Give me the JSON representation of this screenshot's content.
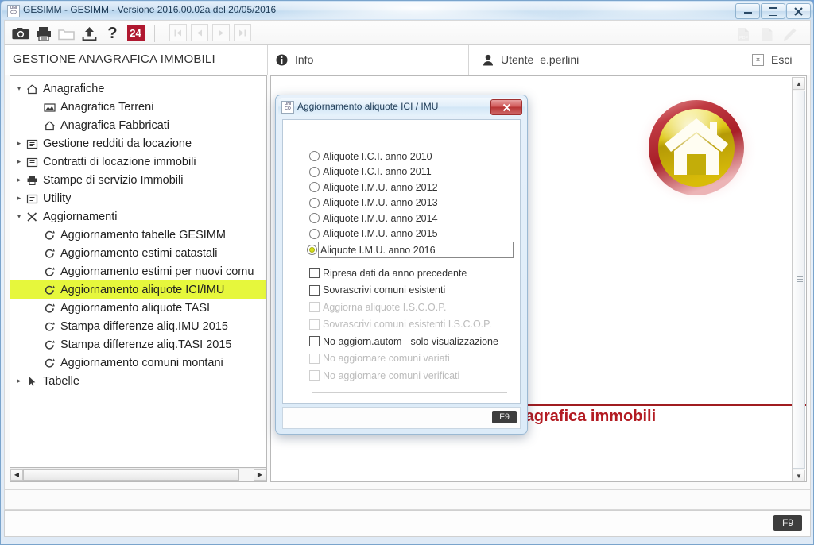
{
  "window": {
    "title": "GESIMM  - GESIMM -  Versione 2016.00.02a  del 20/05/2016",
    "minimize_label": "Minimizza",
    "maximize_label": "Ingrandisci",
    "close_label": "Chiudi"
  },
  "toolbar": {
    "items": [
      {
        "name": "camera-icon",
        "label": "Cattura schermata"
      },
      {
        "name": "print-icon",
        "label": "Stampa"
      },
      {
        "name": "folder-icon",
        "label": "Apri cartella"
      },
      {
        "name": "upload-icon",
        "label": "Esporta"
      },
      {
        "name": "help-icon",
        "label": "?"
      },
      {
        "name": "badge-24",
        "label": "24"
      }
    ],
    "badge_text": "24",
    "help_text": "?",
    "nav": [
      {
        "name": "first-record-button",
        "glyph": "|◀"
      },
      {
        "name": "previous-record-button",
        "glyph": "◀"
      },
      {
        "name": "next-record-button",
        "glyph": "▶"
      },
      {
        "name": "last-record-button",
        "glyph": "▶|"
      }
    ],
    "right_items": [
      {
        "name": "pdf-export-icon",
        "label": "PDF"
      },
      {
        "name": "document-icon",
        "label": "Documento"
      },
      {
        "name": "edit-pencil-icon",
        "label": "Modifica"
      }
    ]
  },
  "header": {
    "title": "GESTIONE ANAGRAFICA IMMOBILI",
    "info_label": "Info",
    "user_caption": "Utente",
    "user_name": "e.perlini",
    "exit_label": "Esci",
    "exit_box_glyph": "×"
  },
  "tree": {
    "items": [
      {
        "label": "Anagrafiche",
        "level": 0,
        "twisty": "▾",
        "icon": "house-icon",
        "selected": false
      },
      {
        "label": "Anagrafica Terreni",
        "level": 1,
        "twisty": "",
        "icon": "land-icon",
        "selected": false
      },
      {
        "label": "Anagrafica Fabbricati",
        "level": 1,
        "twisty": "",
        "icon": "house-icon",
        "selected": false
      },
      {
        "label": "Gestione redditi da locazione",
        "level": 0,
        "twisty": "▸",
        "icon": "form-icon",
        "selected": false
      },
      {
        "label": "Contratti di locazione immobili",
        "level": 0,
        "twisty": "▸",
        "icon": "form-icon",
        "selected": false
      },
      {
        "label": "Stampe di servizio Immobili",
        "level": 0,
        "twisty": "▸",
        "icon": "printer-icon",
        "selected": false
      },
      {
        "label": "Utility",
        "level": 0,
        "twisty": "▸",
        "icon": "form-icon",
        "selected": false
      },
      {
        "label": "Aggiornamenti",
        "level": 0,
        "twisty": "▾",
        "icon": "tools-icon",
        "selected": false
      },
      {
        "label": "Aggiornamento tabelle GESIMM",
        "level": 1,
        "twisty": "",
        "icon": "refresh-icon",
        "selected": false
      },
      {
        "label": "Aggiornamento estimi catastali",
        "level": 1,
        "twisty": "",
        "icon": "refresh-icon",
        "selected": false
      },
      {
        "label": "Aggiornamento estimi per nuovi comu",
        "level": 1,
        "twisty": "",
        "icon": "refresh-icon",
        "selected": false
      },
      {
        "label": "Aggiornamento aliquote ICI/IMU",
        "level": 1,
        "twisty": "",
        "icon": "refresh-icon",
        "selected": true
      },
      {
        "label": "Aggiornamento aliquote TASI",
        "level": 1,
        "twisty": "",
        "icon": "refresh-icon",
        "selected": false
      },
      {
        "label": "Stampa differenze aliq.IMU 2015",
        "level": 1,
        "twisty": "",
        "icon": "refresh-icon",
        "selected": false
      },
      {
        "label": "Stampa differenze aliq.TASI 2015",
        "level": 1,
        "twisty": "",
        "icon": "refresh-icon",
        "selected": false
      },
      {
        "label": "Aggiornamento comuni montani",
        "level": 1,
        "twisty": "",
        "icon": "refresh-icon",
        "selected": false
      },
      {
        "label": "Tabelle",
        "level": 0,
        "twisty": "▸",
        "icon": "pointer-icon",
        "selected": false
      }
    ],
    "hscroll_left_glyph": "◀",
    "hscroll_right_glyph": "▶"
  },
  "content": {
    "logo_name": "home-logo",
    "banner_text": "tione anagrafica immobili",
    "scroll_up_glyph": "▲",
    "scroll_down_glyph": "▼"
  },
  "dialog": {
    "title": "Aggiornamento aliquote ICI / IMU",
    "close_glyph": "✕",
    "radios": [
      {
        "label": "Aliquote I.C.I. anno 2010",
        "selected": false,
        "boxed": false
      },
      {
        "label": "Aliquote I.C.I. anno 2011",
        "selected": false,
        "boxed": false
      },
      {
        "label": "Aliquote I.M.U. anno 2012",
        "selected": false,
        "boxed": false
      },
      {
        "label": "Aliquote I.M.U. anno 2013",
        "selected": false,
        "boxed": false
      },
      {
        "label": "Aliquote I.M.U. anno 2014",
        "selected": false,
        "boxed": false
      },
      {
        "label": "Aliquote I.M.U. anno 2015",
        "selected": false,
        "boxed": false
      },
      {
        "label": "Aliquote I.M.U. anno 2016",
        "selected": true,
        "boxed": true
      }
    ],
    "checkboxes": [
      {
        "label": "Ripresa dati da anno precedente",
        "checked": false,
        "disabled": false
      },
      {
        "label": "Sovrascrivi comuni esistenti",
        "checked": false,
        "disabled": false
      },
      {
        "label": "Aggiorna aliquote I.S.C.O.P.",
        "checked": false,
        "disabled": true
      },
      {
        "label": "Sovrascrivi comuni esistenti I.S.C.O.P.",
        "checked": false,
        "disabled": true
      },
      {
        "label": "No aggiorn.autom - solo visualizzazione",
        "checked": false,
        "disabled": false
      },
      {
        "label": "No aggiornare comuni variati",
        "checked": false,
        "disabled": true
      },
      {
        "label": "No aggiornare comuni verificati",
        "checked": false,
        "disabled": true
      }
    ],
    "footer_key": "F9"
  },
  "footer": {
    "f9_key": "F9"
  },
  "colors": {
    "selection_highlight": "#e6f73c",
    "banner_red": "#b31b22",
    "badge_red": "#b01830",
    "radio_dot": "#d5de1c",
    "titlebar_blue": "#cfe2f3"
  }
}
